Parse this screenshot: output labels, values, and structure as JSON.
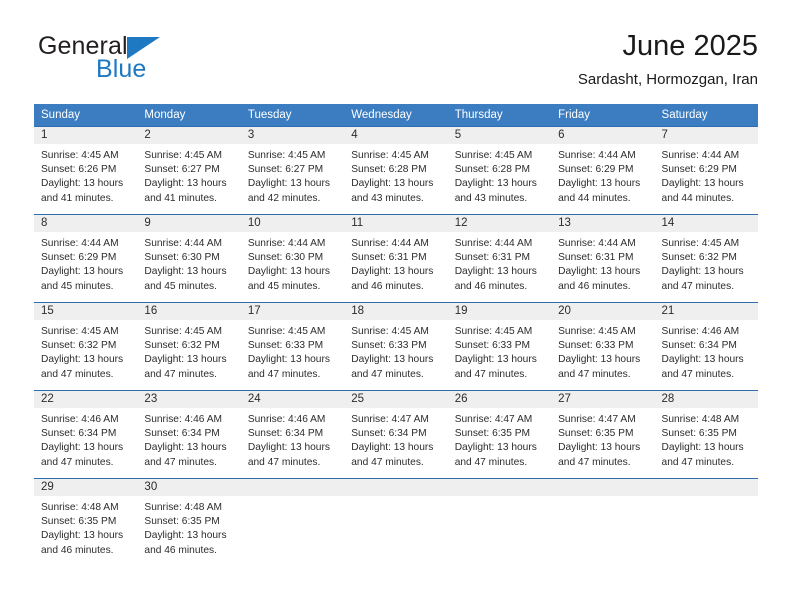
{
  "brand": {
    "name_top": "General",
    "name_bottom": "Blue",
    "triangle_color": "#1e78c2",
    "text_color": "#231f20"
  },
  "header": {
    "title": "June 2025",
    "subtitle": "Sardasht, Hormozgan, Iran"
  },
  "theme": {
    "header_bg": "#3b7dc0",
    "header_text": "#ffffff",
    "row_rule": "#2e6daf",
    "daynum_band_bg": "#efefef",
    "body_text": "#2c2c2c"
  },
  "weekday_headers": [
    "Sunday",
    "Monday",
    "Tuesday",
    "Wednesday",
    "Thursday",
    "Friday",
    "Saturday"
  ],
  "weeks": [
    {
      "days": [
        {
          "day": "1",
          "sunrise": "Sunrise: 4:45 AM",
          "sunset": "Sunset: 6:26 PM",
          "daylight1": "Daylight: 13 hours",
          "daylight2": "and 41 minutes."
        },
        {
          "day": "2",
          "sunrise": "Sunrise: 4:45 AM",
          "sunset": "Sunset: 6:27 PM",
          "daylight1": "Daylight: 13 hours",
          "daylight2": "and 41 minutes."
        },
        {
          "day": "3",
          "sunrise": "Sunrise: 4:45 AM",
          "sunset": "Sunset: 6:27 PM",
          "daylight1": "Daylight: 13 hours",
          "daylight2": "and 42 minutes."
        },
        {
          "day": "4",
          "sunrise": "Sunrise: 4:45 AM",
          "sunset": "Sunset: 6:28 PM",
          "daylight1": "Daylight: 13 hours",
          "daylight2": "and 43 minutes."
        },
        {
          "day": "5",
          "sunrise": "Sunrise: 4:45 AM",
          "sunset": "Sunset: 6:28 PM",
          "daylight1": "Daylight: 13 hours",
          "daylight2": "and 43 minutes."
        },
        {
          "day": "6",
          "sunrise": "Sunrise: 4:44 AM",
          "sunset": "Sunset: 6:29 PM",
          "daylight1": "Daylight: 13 hours",
          "daylight2": "and 44 minutes."
        },
        {
          "day": "7",
          "sunrise": "Sunrise: 4:44 AM",
          "sunset": "Sunset: 6:29 PM",
          "daylight1": "Daylight: 13 hours",
          "daylight2": "and 44 minutes."
        }
      ]
    },
    {
      "days": [
        {
          "day": "8",
          "sunrise": "Sunrise: 4:44 AM",
          "sunset": "Sunset: 6:29 PM",
          "daylight1": "Daylight: 13 hours",
          "daylight2": "and 45 minutes."
        },
        {
          "day": "9",
          "sunrise": "Sunrise: 4:44 AM",
          "sunset": "Sunset: 6:30 PM",
          "daylight1": "Daylight: 13 hours",
          "daylight2": "and 45 minutes."
        },
        {
          "day": "10",
          "sunrise": "Sunrise: 4:44 AM",
          "sunset": "Sunset: 6:30 PM",
          "daylight1": "Daylight: 13 hours",
          "daylight2": "and 45 minutes."
        },
        {
          "day": "11",
          "sunrise": "Sunrise: 4:44 AM",
          "sunset": "Sunset: 6:31 PM",
          "daylight1": "Daylight: 13 hours",
          "daylight2": "and 46 minutes."
        },
        {
          "day": "12",
          "sunrise": "Sunrise: 4:44 AM",
          "sunset": "Sunset: 6:31 PM",
          "daylight1": "Daylight: 13 hours",
          "daylight2": "and 46 minutes."
        },
        {
          "day": "13",
          "sunrise": "Sunrise: 4:44 AM",
          "sunset": "Sunset: 6:31 PM",
          "daylight1": "Daylight: 13 hours",
          "daylight2": "and 46 minutes."
        },
        {
          "day": "14",
          "sunrise": "Sunrise: 4:45 AM",
          "sunset": "Sunset: 6:32 PM",
          "daylight1": "Daylight: 13 hours",
          "daylight2": "and 47 minutes."
        }
      ]
    },
    {
      "days": [
        {
          "day": "15",
          "sunrise": "Sunrise: 4:45 AM",
          "sunset": "Sunset: 6:32 PM",
          "daylight1": "Daylight: 13 hours",
          "daylight2": "and 47 minutes."
        },
        {
          "day": "16",
          "sunrise": "Sunrise: 4:45 AM",
          "sunset": "Sunset: 6:32 PM",
          "daylight1": "Daylight: 13 hours",
          "daylight2": "and 47 minutes."
        },
        {
          "day": "17",
          "sunrise": "Sunrise: 4:45 AM",
          "sunset": "Sunset: 6:33 PM",
          "daylight1": "Daylight: 13 hours",
          "daylight2": "and 47 minutes."
        },
        {
          "day": "18",
          "sunrise": "Sunrise: 4:45 AM",
          "sunset": "Sunset: 6:33 PM",
          "daylight1": "Daylight: 13 hours",
          "daylight2": "and 47 minutes."
        },
        {
          "day": "19",
          "sunrise": "Sunrise: 4:45 AM",
          "sunset": "Sunset: 6:33 PM",
          "daylight1": "Daylight: 13 hours",
          "daylight2": "and 47 minutes."
        },
        {
          "day": "20",
          "sunrise": "Sunrise: 4:45 AM",
          "sunset": "Sunset: 6:33 PM",
          "daylight1": "Daylight: 13 hours",
          "daylight2": "and 47 minutes."
        },
        {
          "day": "21",
          "sunrise": "Sunrise: 4:46 AM",
          "sunset": "Sunset: 6:34 PM",
          "daylight1": "Daylight: 13 hours",
          "daylight2": "and 47 minutes."
        }
      ]
    },
    {
      "days": [
        {
          "day": "22",
          "sunrise": "Sunrise: 4:46 AM",
          "sunset": "Sunset: 6:34 PM",
          "daylight1": "Daylight: 13 hours",
          "daylight2": "and 47 minutes."
        },
        {
          "day": "23",
          "sunrise": "Sunrise: 4:46 AM",
          "sunset": "Sunset: 6:34 PM",
          "daylight1": "Daylight: 13 hours",
          "daylight2": "and 47 minutes."
        },
        {
          "day": "24",
          "sunrise": "Sunrise: 4:46 AM",
          "sunset": "Sunset: 6:34 PM",
          "daylight1": "Daylight: 13 hours",
          "daylight2": "and 47 minutes."
        },
        {
          "day": "25",
          "sunrise": "Sunrise: 4:47 AM",
          "sunset": "Sunset: 6:34 PM",
          "daylight1": "Daylight: 13 hours",
          "daylight2": "and 47 minutes."
        },
        {
          "day": "26",
          "sunrise": "Sunrise: 4:47 AM",
          "sunset": "Sunset: 6:35 PM",
          "daylight1": "Daylight: 13 hours",
          "daylight2": "and 47 minutes."
        },
        {
          "day": "27",
          "sunrise": "Sunrise: 4:47 AM",
          "sunset": "Sunset: 6:35 PM",
          "daylight1": "Daylight: 13 hours",
          "daylight2": "and 47 minutes."
        },
        {
          "day": "28",
          "sunrise": "Sunrise: 4:48 AM",
          "sunset": "Sunset: 6:35 PM",
          "daylight1": "Daylight: 13 hours",
          "daylight2": "and 47 minutes."
        }
      ]
    },
    {
      "days": [
        {
          "day": "29",
          "sunrise": "Sunrise: 4:48 AM",
          "sunset": "Sunset: 6:35 PM",
          "daylight1": "Daylight: 13 hours",
          "daylight2": "and 46 minutes."
        },
        {
          "day": "30",
          "sunrise": "Sunrise: 4:48 AM",
          "sunset": "Sunset: 6:35 PM",
          "daylight1": "Daylight: 13 hours",
          "daylight2": "and 46 minutes."
        },
        {
          "day": "",
          "sunrise": "",
          "sunset": "",
          "daylight1": "",
          "daylight2": ""
        },
        {
          "day": "",
          "sunrise": "",
          "sunset": "",
          "daylight1": "",
          "daylight2": ""
        },
        {
          "day": "",
          "sunrise": "",
          "sunset": "",
          "daylight1": "",
          "daylight2": ""
        },
        {
          "day": "",
          "sunrise": "",
          "sunset": "",
          "daylight1": "",
          "daylight2": ""
        },
        {
          "day": "",
          "sunrise": "",
          "sunset": "",
          "daylight1": "",
          "daylight2": ""
        }
      ]
    }
  ]
}
